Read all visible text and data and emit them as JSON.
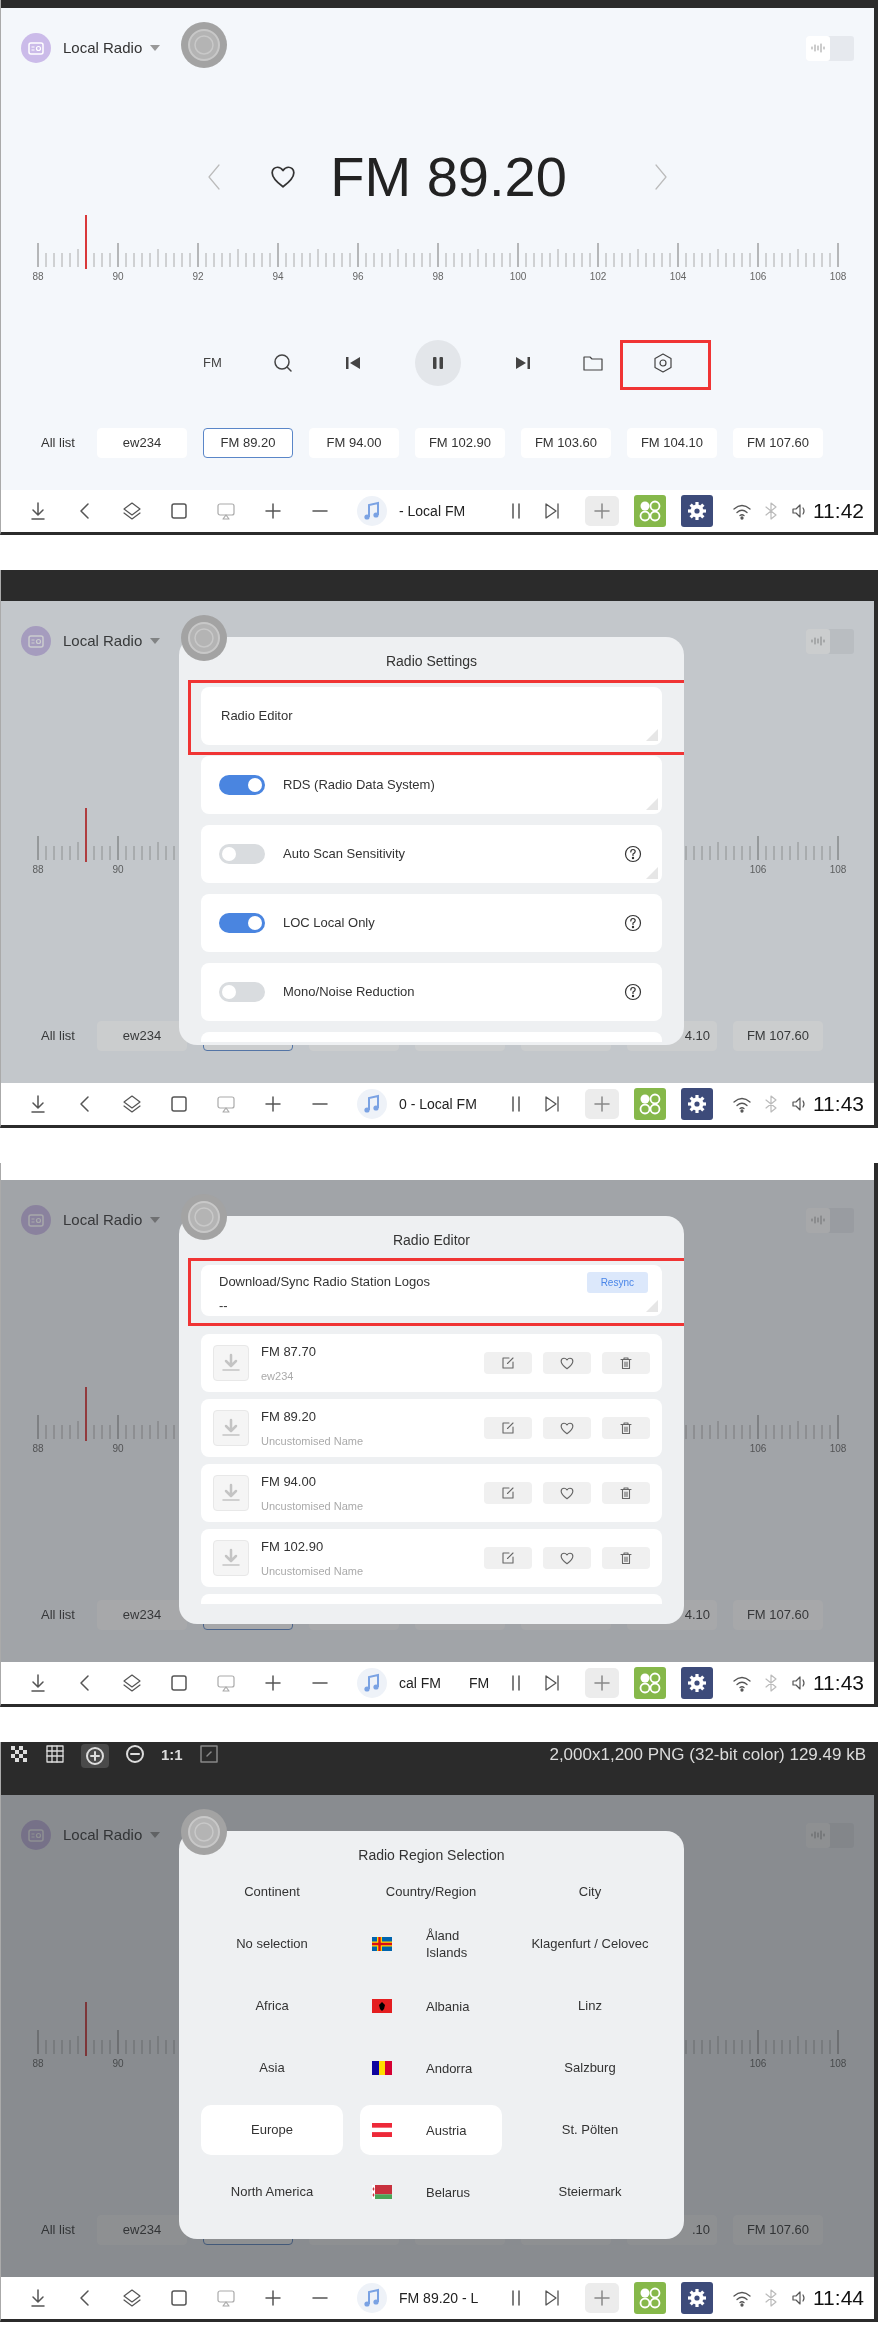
{
  "screenshots": [
    {
      "top_bar": {
        "kind": "plain"
      },
      "app": {
        "title": "Local Radio",
        "sound_toggle": {
          "on": false
        },
        "frequency": "FM 89.20",
        "tuner": {
          "level": 0.06
        },
        "scale_labels": [
          "88",
          "90",
          "92",
          "94",
          "96",
          "98",
          "100",
          "102",
          "104",
          "106",
          "108"
        ],
        "controls": {
          "band": "FM",
          "playing": true,
          "settings_highlighted": true
        },
        "presets_label": "All list",
        "presets": [
          {
            "label": "ew234",
            "selected": false
          },
          {
            "label": "FM 89.20",
            "selected": true
          },
          {
            "label": "FM 94.00",
            "selected": false
          },
          {
            "label": "FM 102.90",
            "selected": false
          },
          {
            "label": "FM 103.60",
            "selected": false
          },
          {
            "label": "FM 104.10",
            "selected": false
          },
          {
            "label": "FM 107.60",
            "selected": false
          }
        ]
      },
      "taskbar": {
        "now_playing": [
          "- Local FM"
        ],
        "time": "11:42"
      }
    },
    {
      "top_bar": {
        "kind": "dark"
      },
      "app": {
        "title": "Local Radio",
        "sound_toggle": {
          "on": false
        },
        "tuner": {
          "level": 0.06
        },
        "scale_labels": [
          "88",
          "90",
          "106",
          "108"
        ],
        "presets_label": "All list",
        "presets": [
          {
            "label": "ew234",
            "selected": false
          },
          {
            "selected": true
          },
          {
            "selected": false
          },
          {
            "selected": false
          },
          {
            "selected": false
          },
          {
            "label": "4.10",
            "selected": false,
            "clipped": true
          },
          {
            "label": "FM 107.60",
            "selected": false
          }
        ]
      },
      "modal": {
        "kind": "settings",
        "title": "Radio Settings",
        "rows": [
          {
            "kind": "link",
            "label": "Radio Editor",
            "highlighted": true,
            "corner_mark": true
          },
          {
            "kind": "switch",
            "label": "RDS (Radio Data System)",
            "on": true,
            "help": false,
            "corner_mark": true
          },
          {
            "kind": "switch",
            "label": "Auto Scan Sensitivity",
            "on": false,
            "help": true,
            "corner_mark": true
          },
          {
            "kind": "switch",
            "label": "LOC Local Only",
            "on": true,
            "help": true,
            "corner_mark": false
          },
          {
            "kind": "switch",
            "label": "Mono/Noise Reduction",
            "on": false,
            "help": true,
            "corner_mark": false
          }
        ]
      },
      "taskbar": {
        "now_playing": [
          "0 - Local FM"
        ],
        "time": "11:43"
      }
    },
    {
      "top_bar": {
        "kind": "light"
      },
      "app": {
        "title": "Local Radio",
        "sound_toggle": {
          "on": false
        },
        "tuner": {
          "level": 0.06
        },
        "scale_labels": [
          "88",
          "90",
          "106",
          "108"
        ],
        "presets_label": "All list",
        "presets": [
          {
            "label": "ew234",
            "selected": false
          },
          {
            "selected": true
          },
          {
            "selected": false
          },
          {
            "selected": false
          },
          {
            "selected": false
          },
          {
            "label": "4.10",
            "selected": false,
            "clipped": true
          },
          {
            "label": "FM 107.60",
            "selected": false
          }
        ]
      },
      "modal": {
        "kind": "editor",
        "title": "Radio Editor",
        "sync": {
          "label": "Download/Sync Radio Station Logos",
          "status": "--",
          "button": "Resync",
          "highlighted": true
        },
        "stations": [
          {
            "frequency": "FM 87.70",
            "name": "ew234"
          },
          {
            "frequency": "FM 89.20",
            "name": "Uncustomised Name"
          },
          {
            "frequency": "FM 94.00",
            "name": "Uncustomised Name"
          },
          {
            "frequency": "FM 102.90",
            "name": "Uncustomised Name"
          }
        ]
      },
      "taskbar": {
        "now_playing": [
          "cal FM",
          "FM"
        ],
        "time": "11:43"
      }
    },
    {
      "top_bar": {
        "kind": "viewer",
        "zoom_label": "1:1",
        "info": "2,000x1,200 PNG (32-bit color) 129.49 kB"
      },
      "app": {
        "title": "Local Radio",
        "sound_toggle": {
          "on": false
        },
        "tuner": {
          "level": 0.06
        },
        "scale_labels": [
          "88",
          "90",
          "106",
          "108"
        ],
        "presets_label": "All list",
        "presets": [
          {
            "label": "ew234",
            "selected": false
          },
          {
            "selected": true
          },
          {
            "selected": false
          },
          {
            "selected": false
          },
          {
            "selected": false
          },
          {
            "label": ".10",
            "selected": false,
            "clipped": true
          },
          {
            "label": "FM 107.60",
            "selected": false
          }
        ]
      },
      "modal": {
        "kind": "region",
        "title": "Radio Region Selection",
        "columns": [
          "Continent",
          "Country/Region",
          "City"
        ],
        "continents": [
          {
            "label": "No selection",
            "selected": false
          },
          {
            "label": "Africa",
            "selected": false
          },
          {
            "label": "Asia",
            "selected": false
          },
          {
            "label": "Europe",
            "selected": true
          },
          {
            "label": "North America",
            "selected": false
          }
        ],
        "countries": [
          {
            "label": "Åland Islands",
            "selected": false
          },
          {
            "label": "Albania",
            "selected": false
          },
          {
            "label": "Andorra",
            "selected": false
          },
          {
            "label": "Austria",
            "selected": true
          },
          {
            "label": "Belarus",
            "selected": false
          }
        ],
        "cities": [
          {
            "label": "Klagenfurt / Celovec",
            "selected": false
          },
          {
            "label": "Linz",
            "selected": false
          },
          {
            "label": "Salzburg",
            "selected": false
          },
          {
            "label": "St. Pölten",
            "selected": false
          },
          {
            "label": "Steiermark",
            "selected": false
          }
        ]
      },
      "taskbar": {
        "now_playing": [
          "FM 89.20 - L"
        ],
        "time": "11:44"
      }
    }
  ]
}
